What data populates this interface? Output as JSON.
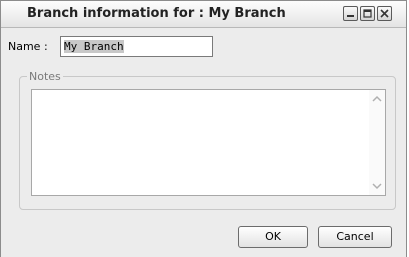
{
  "window": {
    "title": "Branch information for : My Branch",
    "controls": {
      "minimize_icon": "minimize-icon",
      "maximize_icon": "maximize-icon",
      "close_icon": "close-icon"
    }
  },
  "form": {
    "name_label": "Name :",
    "name_value": "My Branch",
    "notes_legend": "Notes",
    "notes_value": ""
  },
  "buttons": {
    "ok": "OK",
    "cancel": "Cancel"
  }
}
